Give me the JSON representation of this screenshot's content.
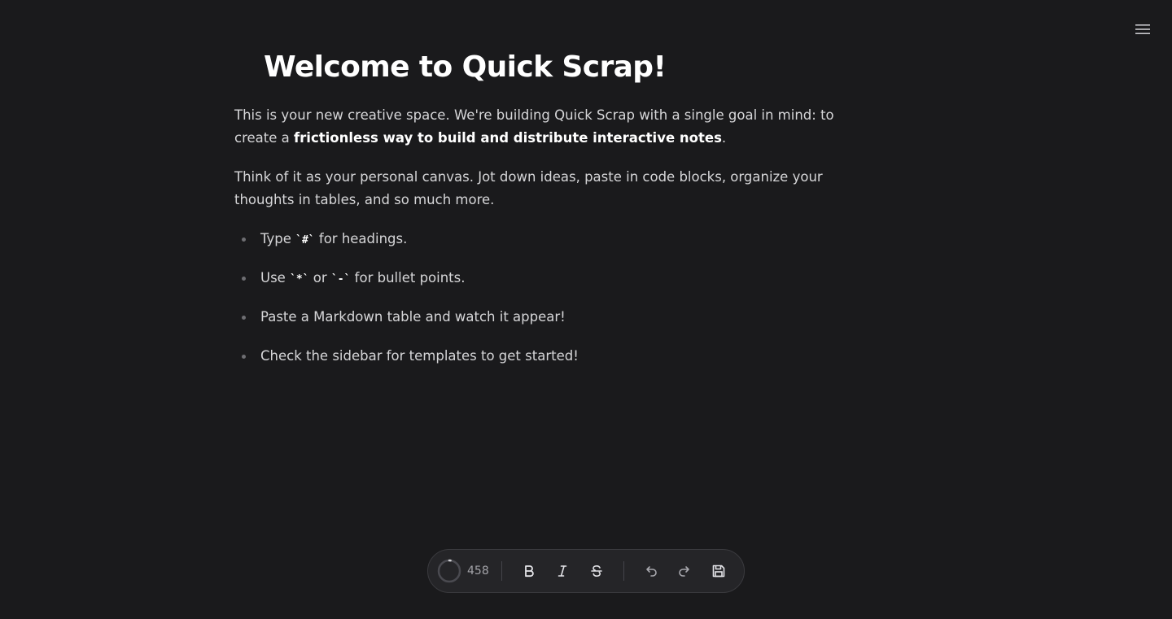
{
  "editor": {
    "title": "Welcome to Quick Scrap!",
    "paragraph1": {
      "text_before": "This is your new creative space. We're building Quick Scrap with a single goal in mind: to create a ",
      "bold": "frictionless way to build and distribute interactive notes",
      "text_after": "."
    },
    "paragraph2": "Think of it as your personal canvas. Jot down ideas, paste in code blocks, organize your thoughts in tables, and so much more.",
    "bullets": [
      {
        "before": "Type ",
        "code": "`#`",
        "after": " for headings."
      },
      {
        "before": "Use ",
        "code": "`*`",
        "middle": " or ",
        "code2": "`-`",
        "after": " for bullet points."
      },
      {
        "before": "Paste a Markdown table and watch it appear!"
      },
      {
        "before": "Check the sidebar for templates to get started!"
      }
    ]
  },
  "toolbar": {
    "word_count": "458",
    "progress": 0.02,
    "buttons": {
      "bold": "bold-icon",
      "italic": "italic-icon",
      "strikethrough": "strikethrough-icon",
      "undo": "undo-icon",
      "redo": "redo-icon",
      "save": "save-icon"
    }
  },
  "header": {
    "menu_icon": "hamburger-menu-icon"
  },
  "colors": {
    "background": "#1a1a1c",
    "text": "#d6d6d8",
    "heading": "#ffffff",
    "toolbar_bg": "#252528"
  }
}
